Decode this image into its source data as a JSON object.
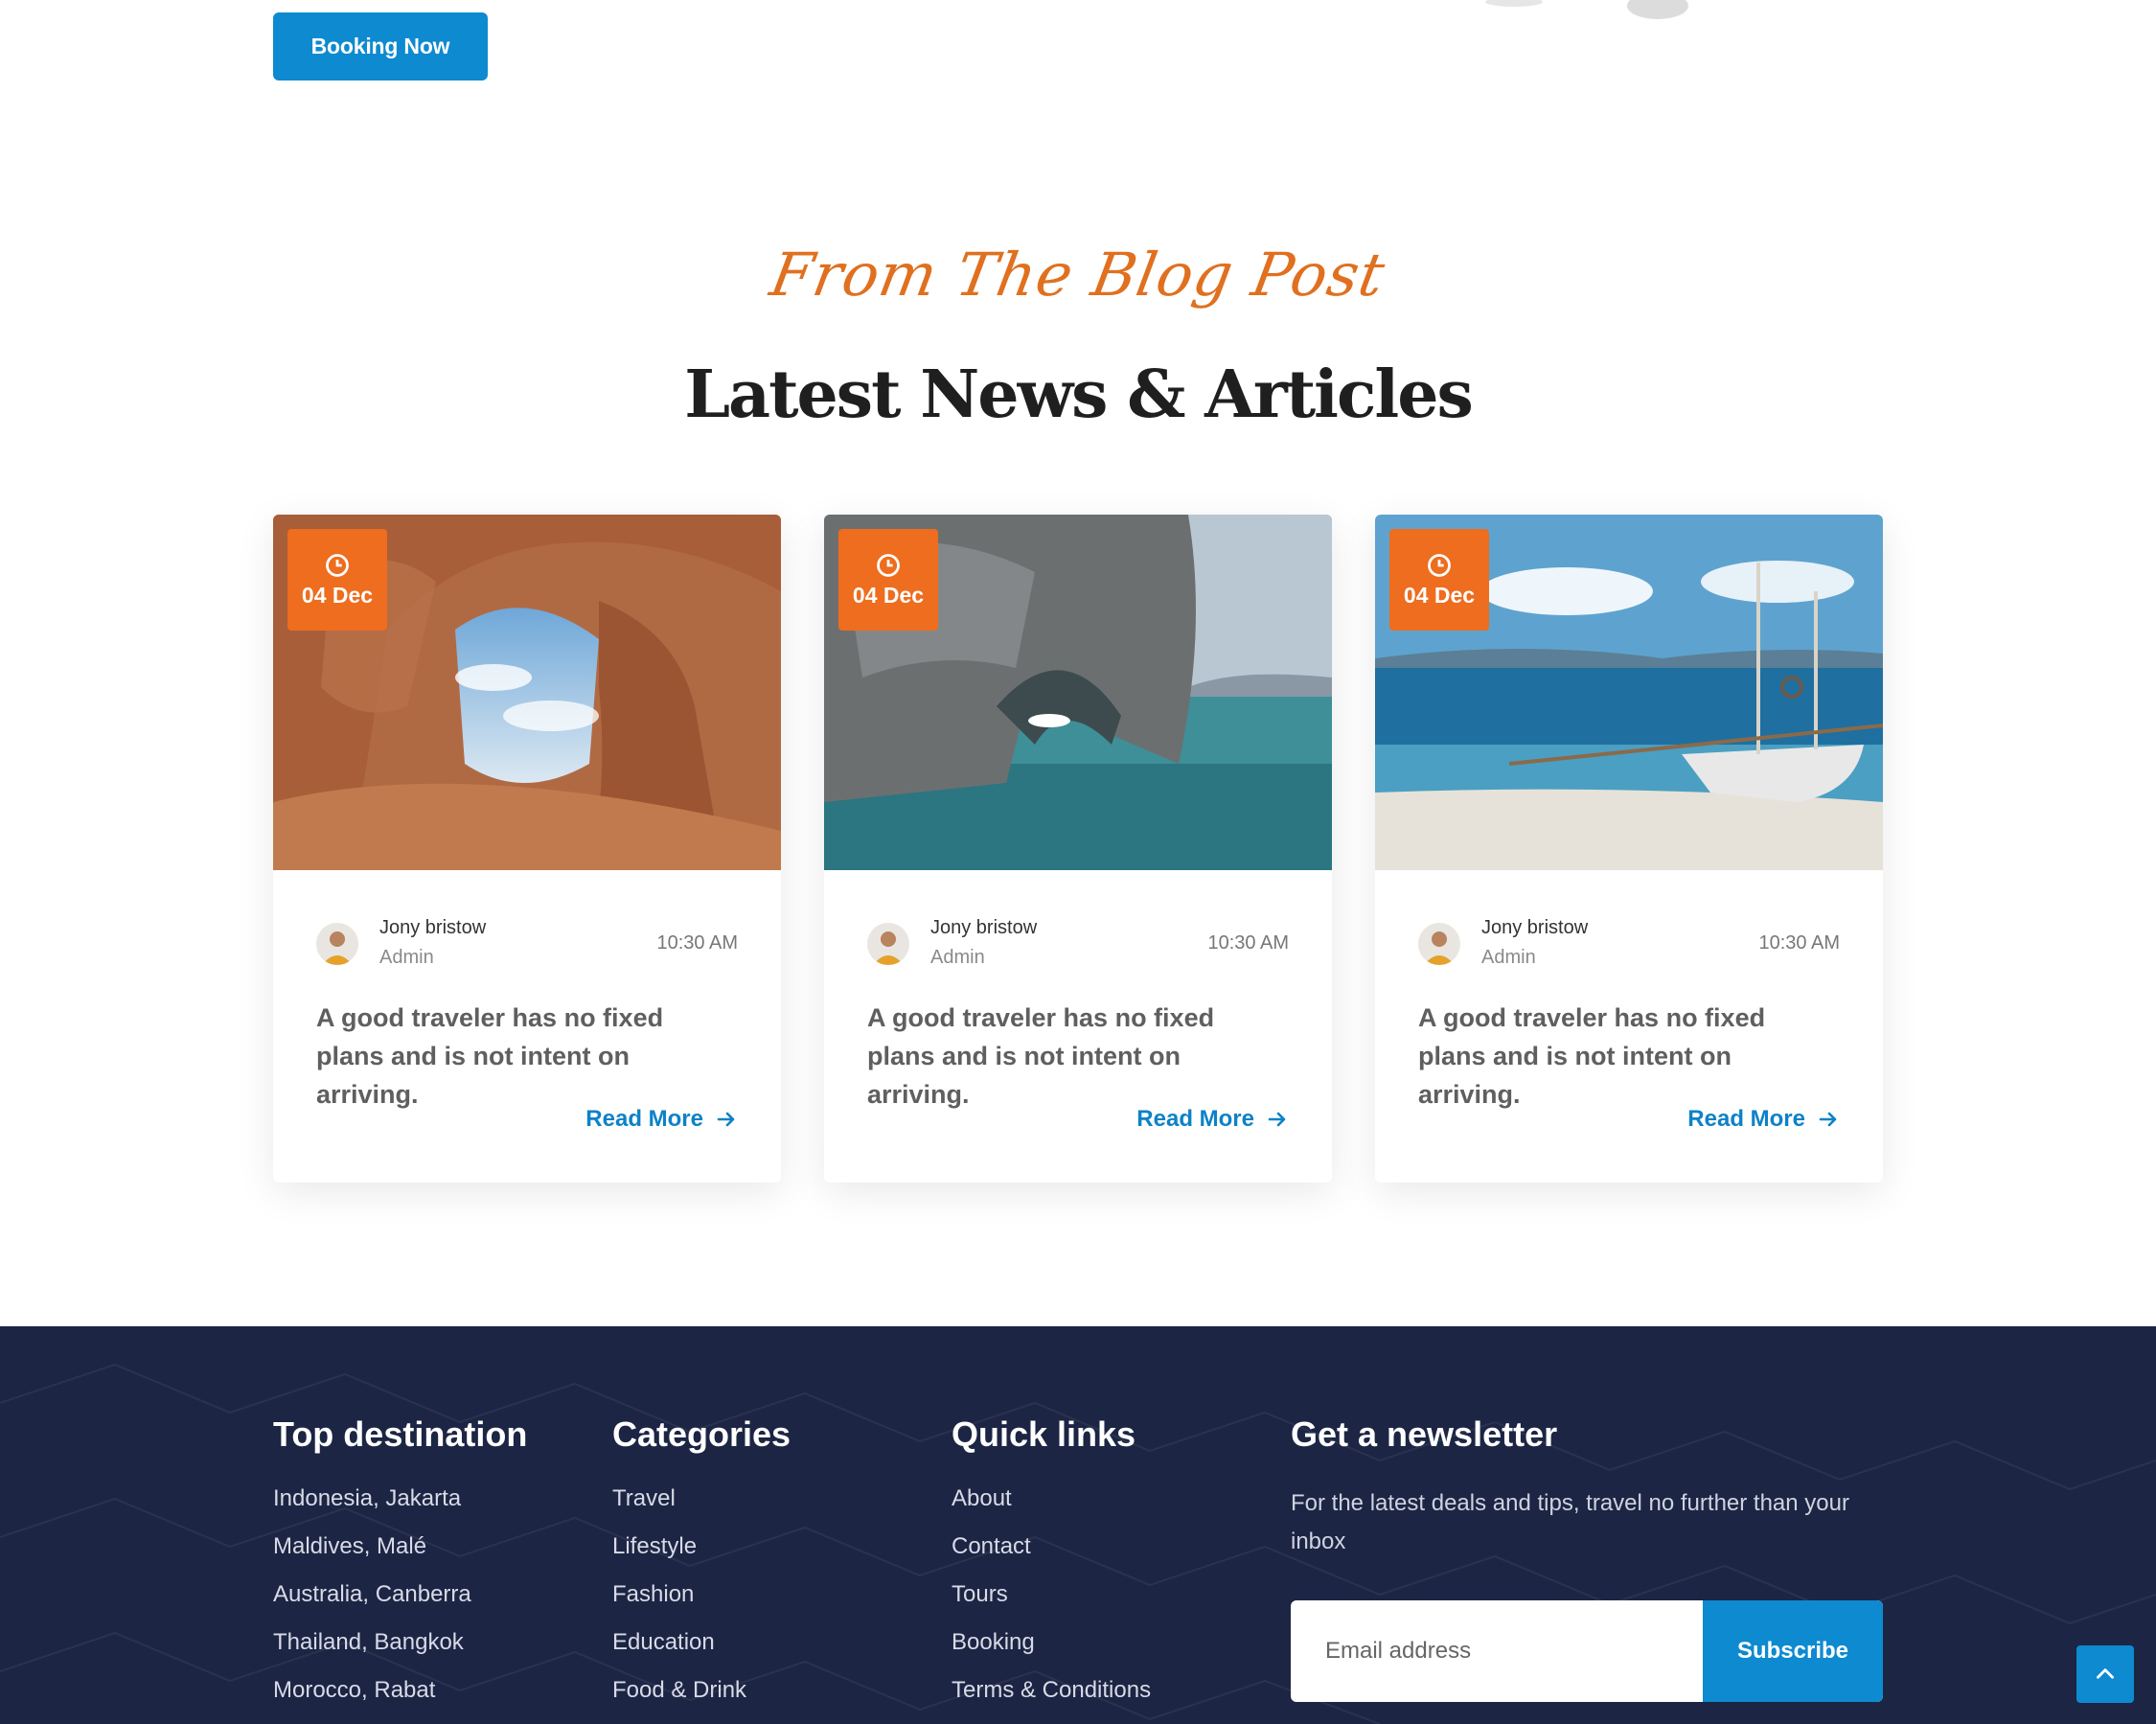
{
  "hero": {
    "booking_label": "Booking Now"
  },
  "blog": {
    "script_title": "From The Blog Post",
    "title": "Latest News & Articles",
    "cards": [
      {
        "date": "04 Dec",
        "author": "Jony bristow",
        "role": "Admin",
        "time": "10:30 AM",
        "title": "A good traveler has no fixed plans and is not intent on arriving.",
        "read_more": "Read More",
        "image": "desert-arch"
      },
      {
        "date": "04 Dec",
        "author": "Jony bristow",
        "role": "Admin",
        "time": "10:30 AM",
        "title": "A good traveler has no fixed plans and is not intent on arriving.",
        "read_more": "Read More",
        "image": "sea-cave"
      },
      {
        "date": "04 Dec",
        "author": "Jony bristow",
        "role": "Admin",
        "time": "10:30 AM",
        "title": "A good traveler has no fixed plans and is not intent on arriving.",
        "read_more": "Read More",
        "image": "beach-boat"
      }
    ]
  },
  "footer": {
    "destinations": {
      "heading": "Top destination",
      "items": [
        "Indonesia, Jakarta",
        "Maldives, Malé",
        "Australia, Canberra",
        "Thailand, Bangkok",
        "Morocco, Rabat"
      ]
    },
    "categories": {
      "heading": "Categories",
      "items": [
        "Travel",
        "Lifestyle",
        "Fashion",
        "Education",
        "Food & Drink"
      ]
    },
    "quick_links": {
      "heading": "Quick links",
      "items": [
        "About",
        "Contact",
        "Tours",
        "Booking",
        "Terms & Conditions"
      ]
    },
    "newsletter": {
      "heading": "Get a newsletter",
      "text": "For the latest deals and tips, travel no further than your inbox",
      "placeholder": "Email address",
      "button": "Subscribe"
    }
  },
  "colors": {
    "accent_blue": "#0d8ad0",
    "accent_orange": "#ee6d1e",
    "footer_bg": "#1c2544"
  },
  "icons": {
    "date": "clock-icon",
    "read_more": "arrow-right-icon",
    "back_to_top": "chevron-up-icon"
  }
}
